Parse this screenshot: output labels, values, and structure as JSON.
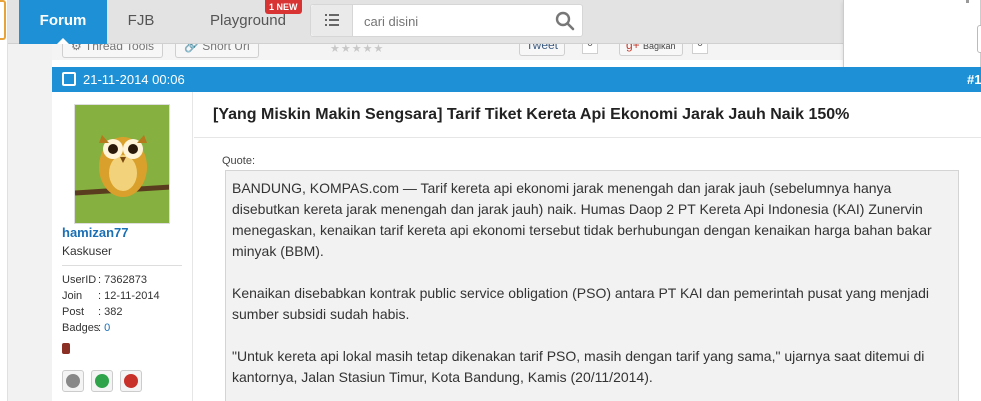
{
  "nav": {
    "forum": "Forum",
    "fjb": "FJB",
    "playground": "Playground",
    "new_badge": "1 NEW"
  },
  "search": {
    "placeholder": "cari disini"
  },
  "subtoolbar": {
    "thread_tools": "Thread Tools",
    "short_url": "Short Url",
    "tweet": "Tweet",
    "tweet_count": "0",
    "share": "Bagikan",
    "share_count": "0"
  },
  "post": {
    "date": "21-11-2014 00:06",
    "number": "#1",
    "title": "[Yang Miskin Makin Sengsara] Tarif Tiket Kereta Api Ekonomi Jarak Jauh Naik 150%",
    "quote_label": "Quote:",
    "quote_paragraphs": [
      "BANDUNG, KOMPAS.com — Tarif kereta api ekonomi jarak menengah dan jarak jauh (sebelumnya hanya disebutkan kereta jarak menengah dan jarak jauh) naik. Humas Daop 2 PT Kereta Api Indonesia (KAI) Zunervin menegaskan, kenaikan tarif kereta api ekonomi tersebut tidak berhubungan dengan kenaikan harga bahan bakar minyak (BBM).",
      "Kenaikan disebabkan kontrak public service obligation (PSO) antara PT KAI dan pemerintah pusat yang menjadi sumber subsidi sudah habis.",
      "\"Untuk kereta api lokal masih tetap dikenakan tarif PSO, masih dengan tarif yang sama,\" ujarnya saat ditemui di kantornya, Jalan Stasiun Timur, Kota Bandung, Kamis (20/11/2014)."
    ]
  },
  "user": {
    "name": "hamizan77",
    "title": "Kaskuser",
    "userid_label": "UserID",
    "userid": ": 7362873",
    "join_label": "Join",
    "join": ": 12-11-2014",
    "post_label": "Post",
    "post": ": 382",
    "badges_label": "Badges",
    "badges_sep": ": ",
    "badges": "0"
  },
  "colors": {
    "accent": "#1e91d6",
    "new_badge": "#d93434",
    "username": "#1b6fb5"
  }
}
